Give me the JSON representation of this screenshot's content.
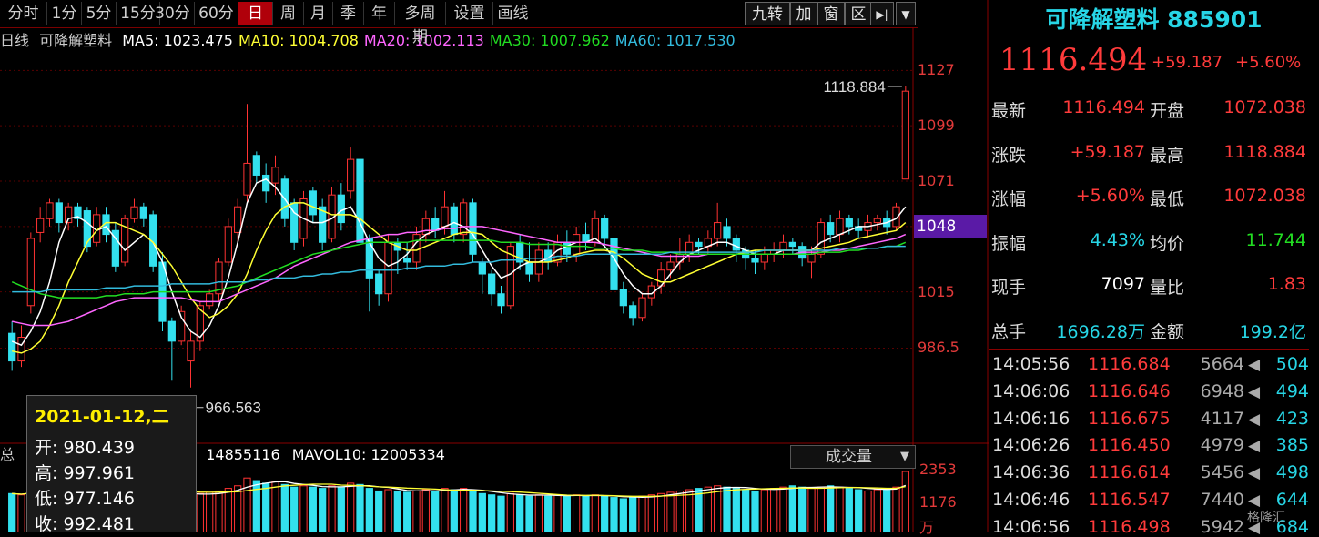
{
  "toolbar": {
    "periods": [
      "分时",
      "1分",
      "5分",
      "15分",
      "30分",
      "60分",
      "日",
      "周",
      "月",
      "季",
      "年",
      "多周期",
      "设置",
      "画线"
    ],
    "active": "日",
    "right_buttons": [
      "九转",
      "加",
      "窗",
      "区"
    ],
    "icon_names": [
      "goto-end-icon",
      "dropdown-icon"
    ]
  },
  "legend": {
    "period": "日线",
    "name": "可降解塑料",
    "ma": [
      {
        "label": "MA5: 1023.475",
        "color": "#ffffff"
      },
      {
        "label": "MA10: 1004.708",
        "color": "#ffff33"
      },
      {
        "label": "MA20: 1002.113",
        "color": "#ff66ff"
      },
      {
        "label": "MA30: 1007.962",
        "color": "#22dd22"
      },
      {
        "label": "MA60: 1017.530",
        "color": "#33bbdd"
      }
    ]
  },
  "panel": {
    "title": "可降解塑料 885901",
    "price": "1116.494",
    "change": "+59.187",
    "pct": "+5.60%",
    "quotes": [
      {
        "l1": "最新",
        "v1": "1116.494",
        "c1": "#ff3b3b",
        "l2": "开盘",
        "v2": "1072.038",
        "c2": "#ff3b3b"
      },
      {
        "l1": "涨跌",
        "v1": "+59.187",
        "c1": "#ff3b3b",
        "l2": "最高",
        "v2": "1118.884",
        "c2": "#ff3b3b"
      },
      {
        "l1": "涨幅",
        "v1": "+5.60%",
        "c1": "#ff3b3b",
        "l2": "最低",
        "v2": "1072.038",
        "c2": "#ff3b3b"
      },
      {
        "l1": "振幅",
        "v1": "4.43%",
        "c1": "#27d6e6",
        "l2": "均价",
        "v2": "11.744",
        "c2": "#22dd22"
      },
      {
        "l1": "现手",
        "v1": "7097",
        "c1": "#ffffff",
        "l2": "量比",
        "v2": "1.83",
        "c2": "#ff3b3b"
      },
      {
        "l1": "总手",
        "v1": "1696.28万",
        "c1": "#27d6e6",
        "l2": "金额",
        "v2": "199.2亿",
        "c2": "#27d6e6"
      }
    ],
    "ticks": [
      {
        "time": "14:05:56",
        "price": "1116.684",
        "vol": "5664",
        "num": "504"
      },
      {
        "time": "14:06:06",
        "price": "1116.646",
        "vol": "6948",
        "num": "494"
      },
      {
        "time": "14:06:16",
        "price": "1116.675",
        "vol": "4117",
        "num": "423"
      },
      {
        "time": "14:06:26",
        "price": "1116.450",
        "vol": "4979",
        "num": "385"
      },
      {
        "time": "14:06:36",
        "price": "1116.614",
        "vol": "5456",
        "num": "498"
      },
      {
        "time": "14:06:46",
        "price": "1116.547",
        "vol": "7440",
        "num": "644"
      },
      {
        "time": "14:06:56",
        "price": "1116.498",
        "vol": "5942",
        "num": "684"
      }
    ]
  },
  "tooltip": {
    "date": "2021-01-12,二",
    "rows": [
      "开: 980.439",
      "高: 997.961",
      "低: 977.146",
      "收: 992.481"
    ]
  },
  "volume": {
    "legend_prefix": "总",
    "vol_value": "14855116",
    "mavol10": "MAVOL10: 12005334",
    "select_label": "成交量",
    "ylabels": [
      "2353",
      "1176",
      "万"
    ]
  },
  "watermark": "格隆汇",
  "chart_data": {
    "type": "candlestick",
    "yticks": [
      1127,
      1099,
      1071,
      1048,
      1015,
      986.5
    ],
    "ylim": [
      960,
      1135
    ],
    "current_price": 1048,
    "annotations": [
      {
        "text": "1118.884",
        "value": 1118.884
      },
      {
        "text": "966.563",
        "value": 966.563
      }
    ],
    "candles": [
      [
        994,
        980,
        975,
        1000
      ],
      [
        980,
        992,
        977,
        998
      ],
      [
        1008,
        1042,
        1004,
        1045
      ],
      [
        1045,
        1052,
        1040,
        1058
      ],
      [
        1052,
        1060,
        1048,
        1062
      ],
      [
        1060,
        1050,
        1045,
        1062
      ],
      [
        1050,
        1058,
        1046,
        1060
      ],
      [
        1058,
        1052,
        1048,
        1060
      ],
      [
        1056,
        1038,
        1035,
        1058
      ],
      [
        1040,
        1054,
        1038,
        1058
      ],
      [
        1054,
        1044,
        1040,
        1058
      ],
      [
        1046,
        1028,
        1025,
        1050
      ],
      [
        1030,
        1052,
        1028,
        1054
      ],
      [
        1052,
        1058,
        1050,
        1062
      ],
      [
        1058,
        1052,
        1048,
        1060
      ],
      [
        1054,
        1028,
        1025,
        1056
      ],
      [
        1030,
        1000,
        995,
        1035
      ],
      [
        1000,
        990,
        970,
        1002
      ],
      [
        990,
        1005,
        988,
        1008
      ],
      [
        980,
        990,
        966.563,
        995
      ],
      [
        990,
        1008,
        985,
        1010
      ],
      [
        1008,
        1014,
        1006,
        1016
      ],
      [
        1014,
        1030,
        1010,
        1032
      ],
      [
        1030,
        1048,
        1028,
        1052
      ],
      [
        1045,
        1058,
        1040,
        1062
      ],
      [
        1064,
        1080,
        1060,
        1110
      ],
      [
        1084,
        1074,
        1070,
        1086
      ],
      [
        1074,
        1066,
        1060,
        1080
      ],
      [
        1070,
        1078,
        1064,
        1084
      ],
      [
        1072,
        1052,
        1048,
        1074
      ],
      [
        1060,
        1040,
        1036,
        1062
      ],
      [
        1042,
        1062,
        1038,
        1066
      ],
      [
        1066,
        1054,
        1050,
        1068
      ],
      [
        1058,
        1040,
        1036,
        1062
      ],
      [
        1042,
        1064,
        1040,
        1068
      ],
      [
        1064,
        1050,
        1046,
        1070
      ],
      [
        1066,
        1082,
        1062,
        1088
      ],
      [
        1082,
        1040,
        1036,
        1084
      ],
      [
        1042,
        1022,
        1005,
        1044
      ],
      [
        1024,
        1014,
        1008,
        1026
      ],
      [
        1014,
        1040,
        1010,
        1044
      ],
      [
        1040,
        1036,
        1024,
        1042
      ],
      [
        1032,
        1030,
        1026,
        1040
      ],
      [
        1030,
        1044,
        1026,
        1048
      ],
      [
        1044,
        1052,
        1040,
        1056
      ],
      [
        1052,
        1046,
        1042,
        1058
      ],
      [
        1048,
        1058,
        1044,
        1066
      ],
      [
        1058,
        1044,
        1040,
        1060
      ],
      [
        1044,
        1060,
        1040,
        1062
      ],
      [
        1060,
        1034,
        1030,
        1062
      ],
      [
        1030,
        1024,
        1014,
        1032
      ],
      [
        1024,
        1014,
        1008,
        1026
      ],
      [
        1014,
        1008,
        1004,
        1018
      ],
      [
        1008,
        1038,
        1006,
        1040
      ],
      [
        1040,
        1030,
        1026,
        1044
      ],
      [
        1030,
        1024,
        1020,
        1040
      ],
      [
        1024,
        1036,
        1020,
        1040
      ],
      [
        1036,
        1030,
        1026,
        1040
      ],
      [
        1030,
        1040,
        1028,
        1044
      ],
      [
        1040,
        1034,
        1030,
        1046
      ],
      [
        1034,
        1044,
        1030,
        1048
      ],
      [
        1044,
        1040,
        1036,
        1050
      ],
      [
        1040,
        1052,
        1038,
        1056
      ],
      [
        1052,
        1042,
        1038,
        1054
      ],
      [
        1042,
        1016,
        1012,
        1046
      ],
      [
        1016,
        1008,
        1004,
        1020
      ],
      [
        1008,
        1002,
        998,
        1010
      ],
      [
        1002,
        1012,
        1000,
        1014
      ],
      [
        1012,
        1018,
        1008,
        1020
      ],
      [
        1018,
        1026,
        1014,
        1030
      ],
      [
        1026,
        1030,
        1022,
        1034
      ],
      [
        1030,
        1034,
        1026,
        1042
      ],
      [
        1034,
        1040,
        1030,
        1044
      ],
      [
        1040,
        1038,
        1034,
        1042
      ],
      [
        1038,
        1042,
        1034,
        1046
      ],
      [
        1042,
        1050,
        1038,
        1060
      ],
      [
        1048,
        1042,
        1038,
        1052
      ],
      [
        1042,
        1036,
        1030,
        1044
      ],
      [
        1036,
        1032,
        1026,
        1038
      ],
      [
        1032,
        1030,
        1024,
        1036
      ],
      [
        1030,
        1034,
        1026,
        1038
      ],
      [
        1034,
        1036,
        1030,
        1040
      ],
      [
        1036,
        1040,
        1032,
        1044
      ],
      [
        1040,
        1038,
        1034,
        1042
      ],
      [
        1038,
        1032,
        1028,
        1040
      ],
      [
        1030,
        1034,
        1022,
        1038
      ],
      [
        1034,
        1050,
        1032,
        1052
      ],
      [
        1050,
        1044,
        1040,
        1054
      ],
      [
        1044,
        1052,
        1040,
        1056
      ],
      [
        1052,
        1048,
        1044,
        1054
      ],
      [
        1048,
        1046,
        1042,
        1052
      ],
      [
        1046,
        1050,
        1042,
        1054
      ],
      [
        1050,
        1052,
        1046,
        1054
      ],
      [
        1052,
        1048,
        1044,
        1056
      ],
      [
        1048,
        1058,
        1046,
        1060
      ],
      [
        1072.038,
        1116.494,
        1072.038,
        1118.884
      ]
    ],
    "ma5": [
      990,
      988,
      995,
      1005,
      1020,
      1040,
      1052,
      1053,
      1050,
      1046,
      1048,
      1042,
      1036,
      1040,
      1044,
      1040,
      1030,
      1015,
      1002,
      995,
      992,
      998,
      1008,
      1022,
      1040,
      1060,
      1070,
      1072,
      1068,
      1062,
      1055,
      1052,
      1050,
      1050,
      1052,
      1056,
      1058,
      1050,
      1040,
      1032,
      1028,
      1030,
      1034,
      1040,
      1044,
      1046,
      1048,
      1050,
      1048,
      1044,
      1036,
      1028,
      1022,
      1024,
      1028,
      1030,
      1030,
      1032,
      1036,
      1038,
      1040,
      1040,
      1042,
      1038,
      1032,
      1024,
      1018,
      1014,
      1014,
      1018,
      1024,
      1030,
      1034,
      1036,
      1038,
      1040,
      1040,
      1038,
      1036,
      1034,
      1034,
      1034,
      1036,
      1036,
      1036,
      1036,
      1040,
      1042,
      1044,
      1046,
      1048,
      1048,
      1049,
      1050,
      1052,
      1058
    ],
    "ma10": [
      985,
      984,
      986,
      990,
      998,
      1008,
      1020,
      1030,
      1040,
      1046,
      1050,
      1050,
      1048,
      1046,
      1044,
      1040,
      1034,
      1028,
      1020,
      1012,
      1006,
      1002,
      1004,
      1008,
      1014,
      1024,
      1036,
      1046,
      1054,
      1058,
      1060,
      1060,
      1058,
      1056,
      1054,
      1054,
      1054,
      1052,
      1048,
      1044,
      1040,
      1038,
      1036,
      1036,
      1038,
      1040,
      1042,
      1044,
      1045,
      1045,
      1044,
      1040,
      1036,
      1034,
      1032,
      1030,
      1030,
      1030,
      1031,
      1032,
      1034,
      1035,
      1036,
      1036,
      1035,
      1032,
      1028,
      1024,
      1022,
      1020,
      1020,
      1022,
      1024,
      1026,
      1028,
      1030,
      1032,
      1034,
      1035,
      1036,
      1036,
      1036,
      1036,
      1036,
      1036,
      1036,
      1037,
      1038,
      1039,
      1040,
      1042,
      1043,
      1044,
      1045,
      1046,
      1050
    ],
    "ma20": [
      1000,
      999,
      998,
      998,
      998,
      999,
      1000,
      1002,
      1004,
      1006,
      1008,
      1010,
      1011,
      1012,
      1012,
      1012,
      1012,
      1012,
      1012,
      1011,
      1010,
      1010,
      1010,
      1012,
      1014,
      1016,
      1018,
      1020,
      1022,
      1025,
      1028,
      1030,
      1032,
      1034,
      1036,
      1038,
      1040,
      1041,
      1042,
      1043,
      1044,
      1044,
      1045,
      1045,
      1046,
      1046,
      1047,
      1047,
      1048,
      1048,
      1048,
      1047,
      1046,
      1045,
      1044,
      1043,
      1042,
      1041,
      1040,
      1040,
      1040,
      1040,
      1040,
      1039,
      1038,
      1037,
      1036,
      1035,
      1034,
      1033,
      1033,
      1033,
      1033,
      1033,
      1034,
      1034,
      1034,
      1034,
      1034,
      1034,
      1034,
      1034,
      1034,
      1034,
      1035,
      1035,
      1035,
      1036,
      1036,
      1037,
      1038,
      1039,
      1040,
      1041,
      1042,
      1044
    ],
    "ma30": [
      1020,
      1018,
      1016,
      1014,
      1013,
      1012,
      1012,
      1012,
      1012,
      1012,
      1013,
      1013,
      1014,
      1014,
      1014,
      1015,
      1015,
      1015,
      1015,
      1015,
      1015,
      1015,
      1016,
      1017,
      1018,
      1020,
      1022,
      1024,
      1026,
      1028,
      1030,
      1032,
      1034,
      1035,
      1036,
      1037,
      1038,
      1039,
      1040,
      1040,
      1040,
      1040,
      1040,
      1041,
      1041,
      1041,
      1041,
      1041,
      1041,
      1041,
      1041,
      1041,
      1040,
      1040,
      1040,
      1039,
      1039,
      1039,
      1039,
      1038,
      1038,
      1038,
      1037,
      1037,
      1037,
      1036,
      1036,
      1036,
      1035,
      1035,
      1035,
      1034,
      1034,
      1034,
      1034,
      1034,
      1034,
      1034,
      1034,
      1034,
      1034,
      1034,
      1034,
      1034,
      1034,
      1034,
      1035,
      1035,
      1035,
      1036,
      1036,
      1037,
      1037,
      1038,
      1038,
      1040
    ],
    "ma60": [
      1015,
      1015,
      1015,
      1015,
      1016,
      1016,
      1016,
      1016,
      1016,
      1016,
      1017,
      1017,
      1017,
      1018,
      1018,
      1018,
      1018,
      1019,
      1019,
      1019,
      1019,
      1019,
      1020,
      1020,
      1020,
      1020,
      1021,
      1021,
      1022,
      1022,
      1022,
      1023,
      1023,
      1024,
      1024,
      1025,
      1025,
      1026,
      1026,
      1026,
      1026,
      1026,
      1027,
      1027,
      1028,
      1028,
      1028,
      1029,
      1029,
      1030,
      1030,
      1030,
      1031,
      1031,
      1031,
      1032,
      1032,
      1032,
      1033,
      1033,
      1033,
      1034,
      1034,
      1034,
      1034,
      1034,
      1034,
      1034,
      1034,
      1034,
      1035,
      1035,
      1035,
      1035,
      1035,
      1035,
      1035,
      1035,
      1035,
      1035,
      1036,
      1036,
      1036,
      1036,
      1036,
      1036,
      1036,
      1036,
      1037,
      1037,
      1037,
      1037,
      1037,
      1038,
      1038,
      1038
    ],
    "volume": [
      1500,
      1450,
      1600,
      1700,
      1650,
      1600,
      1550,
      1500,
      1600,
      1650,
      1700,
      1600,
      1550,
      1650,
      1700,
      1650,
      1550,
      1500,
      1450,
      1400,
      1500,
      1550,
      1600,
      1700,
      1800,
      2100,
      2000,
      1900,
      1950,
      1850,
      1750,
      1800,
      1750,
      1700,
      1800,
      1750,
      1900,
      1850,
      1700,
      1600,
      1650,
      1600,
      1550,
      1600,
      1650,
      1600,
      1700,
      1650,
      1700,
      1600,
      1500,
      1450,
      1400,
      1500,
      1450,
      1400,
      1450,
      1400,
      1450,
      1400,
      1450,
      1400,
      1450,
      1400,
      1350,
      1300,
      1350,
      1400,
      1450,
      1500,
      1550,
      1600,
      1650,
      1700,
      1750,
      1800,
      1750,
      1700,
      1650,
      1600,
      1650,
      1700,
      1750,
      1800,
      1750,
      1700,
      1750,
      1800,
      1750,
      1700,
      1650,
      1600,
      1650,
      1700,
      1750,
      2353
    ]
  }
}
